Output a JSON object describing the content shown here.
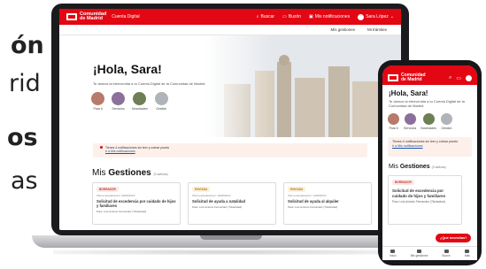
{
  "left_text": {
    "line1": "ón",
    "line2": "rid",
    "line3": "os",
    "line4": "as"
  },
  "colors": {
    "brand_red": "#e30613",
    "notice_bg": "#fdf0ea",
    "link_blue": "#1a56a8"
  },
  "header": {
    "logo_line1": "Comunidad",
    "logo_line2": "de Madrid",
    "app_name": "Cuenta Digital",
    "search_label": "Buscar",
    "buzon_label": "Buzón",
    "notifications_label": "Mis notificaciones",
    "user_label": "Sara López"
  },
  "subnav": {
    "gestiones": "Mis gestiones",
    "tramites": "Mi trámites"
  },
  "hero": {
    "greeting": "¡Hola, Sara!",
    "welcome": "Te damos la bienvenida a tu Cuenta Digital de la Comunidad de Madrid.",
    "shortcuts": [
      {
        "label": "Para ti",
        "color": "#b87a6a"
      },
      {
        "label": "Servicios",
        "color": "#8c6f9a"
      },
      {
        "label": "Novedades",
        "color": "#6f7f55"
      },
      {
        "label": "Gestión",
        "color": "#b0b3b8"
      }
    ]
  },
  "notice": {
    "text": "Tienes 4 notificaciones sin leer y cobrar pronto",
    "link": "Ir a Mis notificaciones"
  },
  "gestiones": {
    "title_light": "Mis",
    "title_bold": "Gestiones",
    "count": "(3 activas)",
    "cards": [
      {
        "badge": "BORRADOR",
        "badge_bg": "#fce8e6",
        "badge_fg": "#c0392b",
        "date": "Última actualización: 06/08/2023",
        "title": "Solicitud de excedencia por cuidado de hijos y familiares",
        "for": "Para: Luis Antonio Fernández (Titularidad)"
      },
      {
        "badge": "ENVIADA",
        "badge_bg": "#fdf1dc",
        "badge_fg": "#b9770e",
        "date": "Última actualización: 16/08/2023",
        "title": "Solicitud de ayuda a natalidad",
        "for": "Para: Luis Antonio Fernández (Titularidad)"
      },
      {
        "badge": "ENVIADA",
        "badge_bg": "#fdf1dc",
        "badge_fg": "#b9770e",
        "date": "Última actualización: 14/08/2023",
        "title": "Solicitud de ayuda al alquiler",
        "for": "Para: Luis Antonio Fernández (Titularidad)"
      }
    ]
  },
  "phone": {
    "greeting": "¡Hola, Sara!",
    "desc": "Te damos la bienvenida a tu Cuenta Digital de la Comunidad de Madrid.",
    "shortcuts": [
      "Para ti",
      "Servicios",
      "Novedades",
      "Gestión"
    ],
    "notice_text": "Tienes 4 notificaciones sin leer y cobrar pronto",
    "notice_link": "Ir a Mis notificaciones",
    "gest_light": "Mis",
    "gest_bold": "Gestiones",
    "gest_count": "(3 activas)",
    "card_badge": "BORRADOR",
    "card_title": "Solicitud de excedencia por cuidado de hijos y familiares",
    "card_for": "Para: Luis Antonio Fernández (Titularidad)",
    "fab": "¿Qué necesitas?",
    "tabs": [
      "Inicio",
      "Mis gestiones",
      "Buzón",
      "Más"
    ]
  }
}
